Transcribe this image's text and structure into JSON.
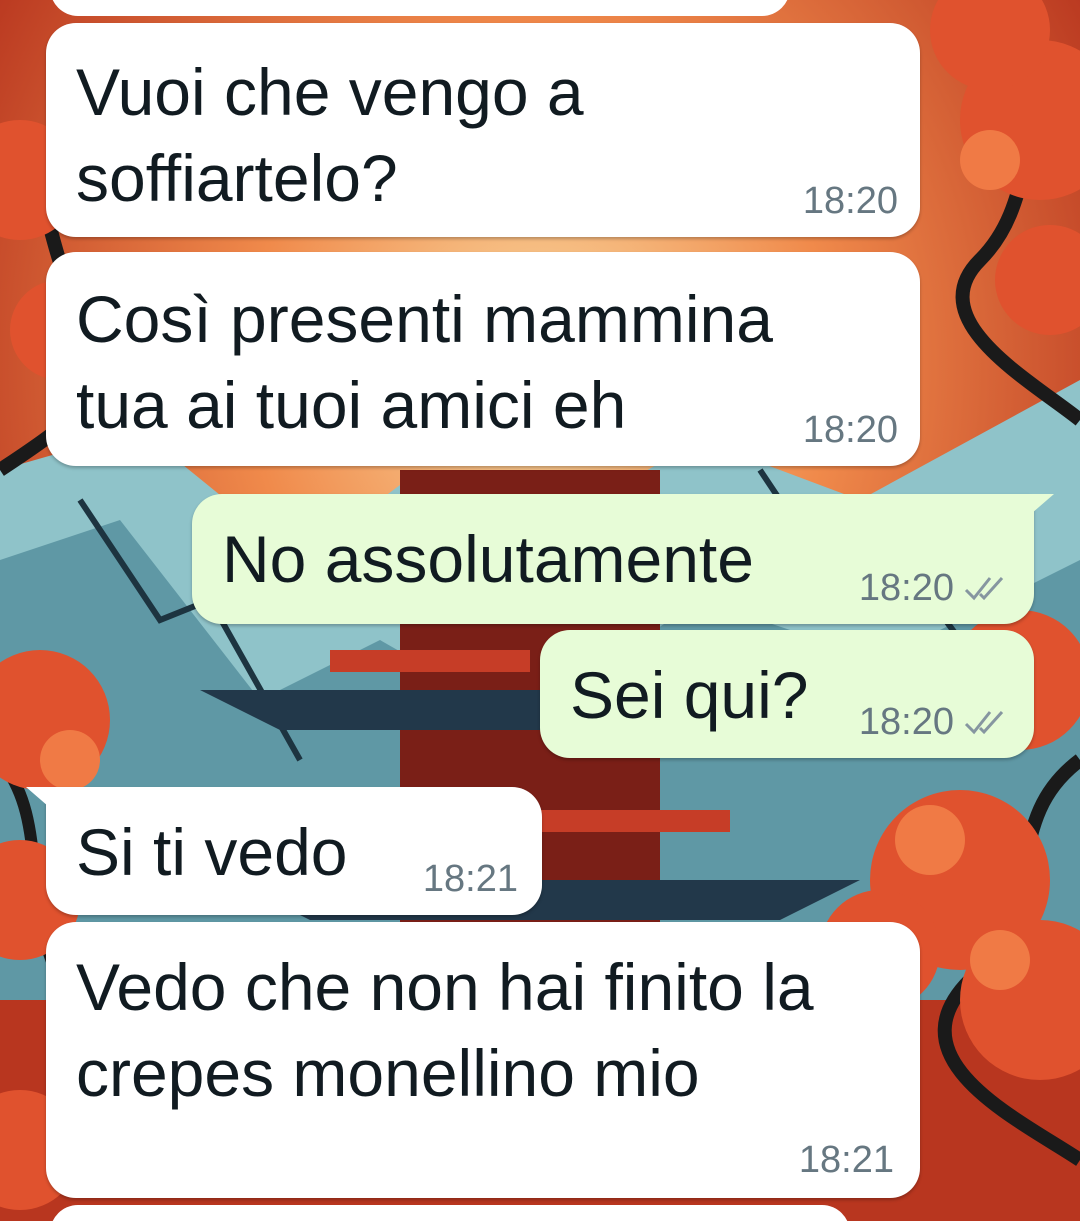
{
  "chat": {
    "messages": [
      {
        "text_lines": [
          "Vuoi che vengo a",
          "soffiartelo?"
        ],
        "time": "18:20",
        "direction": "incoming"
      },
      {
        "text_lines": [
          "Così presenti mammina",
          "tua ai tuoi amici eh"
        ],
        "time": "18:20",
        "direction": "incoming"
      },
      {
        "text_lines": [
          "No assolutamente"
        ],
        "time": "18:20",
        "direction": "outgoing",
        "status": "read-double-check"
      },
      {
        "text_lines": [
          "Sei qui?"
        ],
        "time": "18:20",
        "direction": "outgoing",
        "status": "read-double-check"
      },
      {
        "text_lines": [
          "Si ti vedo"
        ],
        "time": "18:21",
        "direction": "incoming"
      },
      {
        "text_lines": [
          "Vedo che non hai finito la",
          "crepes monellino mio"
        ],
        "time": "18:21",
        "direction": "incoming"
      }
    ]
  },
  "theme": {
    "incoming_bubble": "#ffffff",
    "outgoing_bubble": "#e7fcd7",
    "text_color": "#111b21",
    "time_color": "#667781",
    "check_color": "#8696a0",
    "wallpaper": "japanese-pagoda-mountains-red-trees"
  }
}
